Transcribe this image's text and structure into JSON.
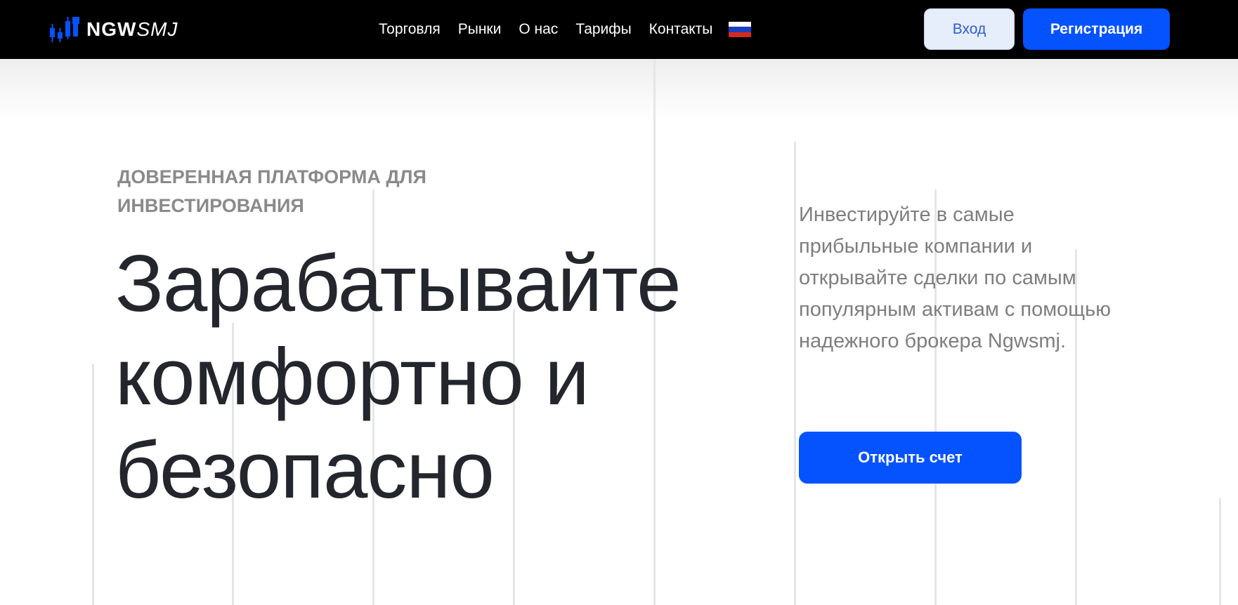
{
  "header": {
    "logo": {
      "bold": "NGW",
      "thin": "SMJ"
    },
    "nav": [
      {
        "label": "Торговля"
      },
      {
        "label": "Рынки"
      },
      {
        "label": "О нас"
      },
      {
        "label": "Тарифы"
      },
      {
        "label": "Контакты"
      }
    ],
    "language_flag_icon": "russia-flag-icon",
    "login_label": "Вход",
    "register_label": "Регистрация"
  },
  "hero": {
    "eyebrow_line1": "Доверенная платформа для",
    "eyebrow_line2": "инвестирования",
    "headline_line1": "Зарабатывайте",
    "headline_line2": "комфортно и",
    "headline_line3": "безопасно",
    "description": "Инвестируйте в самые прибыльные компании и открывайте сделки по самым популярным активам с помощью надежного брокера Ngwsmj.",
    "cta_label": "Открыть счет"
  },
  "colors": {
    "header_bg": "#000000",
    "accent": "#0552ff",
    "login_bg": "#e6edfb",
    "headline": "#23262c",
    "muted_text": "#8a8a8a"
  }
}
